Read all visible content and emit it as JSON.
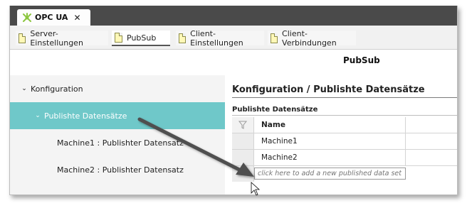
{
  "app_tab": {
    "title": "OPC UA",
    "close_glyph": "✕",
    "icon": "opc-ua-logo-icon"
  },
  "tabs": [
    {
      "label": "Server-Einstellungen",
      "active": false
    },
    {
      "label": "PubSub",
      "active": true
    },
    {
      "label": "Client-Einstellungen",
      "active": false
    },
    {
      "label": "Client-Verbindungen",
      "active": false
    }
  ],
  "page_title": "PubSub",
  "sidebar": {
    "items": [
      {
        "label": "Konfiguration",
        "chevron": "⌄"
      },
      {
        "label": "Publishte Datensätze",
        "chevron": "⌄"
      },
      {
        "label": "Machine1 : Publishter Datensatz"
      },
      {
        "label": "Machine2 : Publishter Datensatz"
      }
    ]
  },
  "main": {
    "heading": "Konfiguration / Publishte Datensätze",
    "grid_title": "Publishte Datensätze",
    "column_header": "Name",
    "rows": [
      "Machine1",
      "Machine2"
    ],
    "add_placeholder": "click here to add a new published data set"
  },
  "colors": {
    "selected": "#6fc8c9",
    "topbar": "#4a4a4a",
    "logo": "#8cc63f"
  }
}
